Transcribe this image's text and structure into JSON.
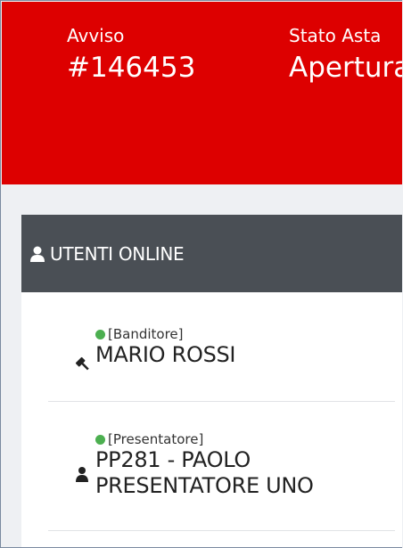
{
  "header": {
    "avviso_label": "Avviso",
    "avviso_value": "#146453",
    "stato_label": "Stato Asta",
    "stato_value": "Apertura"
  },
  "users_panel": {
    "title": "UTENTI ONLINE",
    "users": [
      {
        "role": "[Banditore]",
        "name": "MARIO ROSSI",
        "status": "online",
        "role_icon": "gavel-icon"
      },
      {
        "role": "[Presentatore]",
        "name_line1": "PP281 - PAOLO",
        "name_line2": "PRESENTATORE UNO",
        "status": "online",
        "role_icon": "user-icon"
      }
    ]
  },
  "colors": {
    "header_bg": "#dd0000",
    "panel_head_bg": "#4a4f55",
    "online_dot": "#4caf50"
  }
}
